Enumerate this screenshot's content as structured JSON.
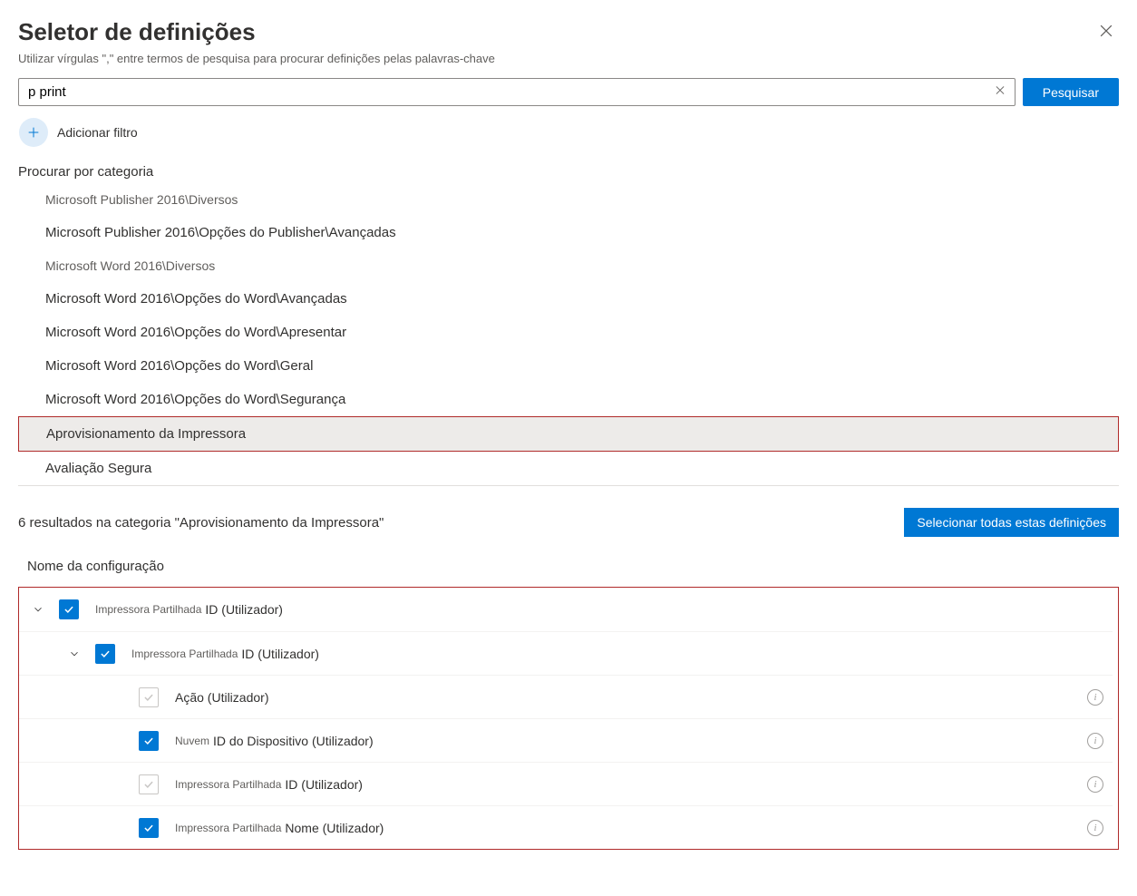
{
  "title": "Seletor de definições",
  "subtitle": "Utilizar vírgulas \",\" entre termos de pesquisa para procurar definições pelas palavras-chave",
  "search": {
    "value": "p print",
    "button": "Pesquisar"
  },
  "addFilter": "Adicionar filtro",
  "categoryLabel": "Procurar por categoria",
  "categories": [
    {
      "label": "Microsoft Publisher 2016\\Diversos",
      "small": true
    },
    {
      "label": "Microsoft Publisher 2016\\Opções do Publisher\\Avançadas"
    },
    {
      "label": "Microsoft Word 2016\\Diversos",
      "small": true
    },
    {
      "label": "Microsoft Word 2016\\Opções do Word\\Avançadas"
    },
    {
      "label": "Microsoft Word 2016\\Opções do Word\\Apresentar"
    },
    {
      "label": "Microsoft Word 2016\\Opções do Word\\Geral"
    },
    {
      "label": "Microsoft Word 2016\\Opções do Word\\Segurança"
    },
    {
      "label": "Aprovisionamento da Impressora",
      "highlighted": true
    },
    {
      "label": "Avaliação Segura"
    }
  ],
  "results": {
    "count": "6 resultados na categoria \"Aprovisionamento da Impressora\"",
    "selectAll": "Selecionar todas estas definições"
  },
  "configNameLabel": "Nome da configuração",
  "tree": [
    {
      "indent": 0,
      "chevron": true,
      "checked": true,
      "prefix": "Impressora Partilhada",
      "main": "ID (Utilizador)",
      "info": false
    },
    {
      "indent": 1,
      "chevron": true,
      "checked": true,
      "prefix": "Impressora Partilhada",
      "main": "ID (Utilizador)",
      "info": false
    },
    {
      "indent": 2,
      "chevron": false,
      "checked": false,
      "prefix": "",
      "main": "Ação (Utilizador)",
      "info": true
    },
    {
      "indent": 2,
      "chevron": false,
      "checked": true,
      "prefix": "Nuvem",
      "main": "ID do Dispositivo (Utilizador)",
      "info": true
    },
    {
      "indent": 2,
      "chevron": false,
      "checked": false,
      "prefix": "Impressora Partilhada",
      "main": "ID (Utilizador)",
      "info": true
    },
    {
      "indent": 2,
      "chevron": false,
      "checked": true,
      "prefix": "Impressora Partilhada",
      "main": "Nome (Utilizador)",
      "info": true
    }
  ]
}
